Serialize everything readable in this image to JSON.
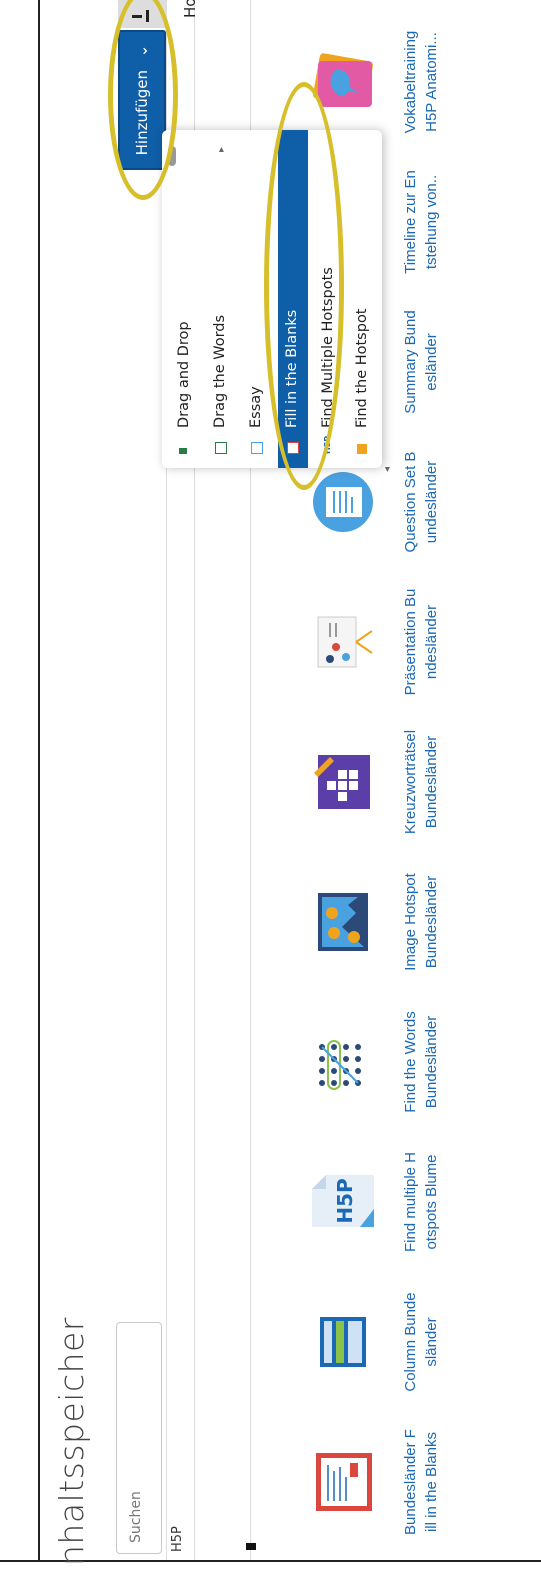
{
  "page_title": "nhaltsspeicher",
  "search": {
    "placeholder": "Suchen"
  },
  "breadcrumb": "H5P",
  "toolbar": {
    "add_label": "Hinzufügen",
    "add_chevron": "⌄",
    "upload_label": "Hochladen",
    "upload_icon": "upload-icon"
  },
  "tiles": [
    {
      "name": "Bundesländer F\nill in the Blanks",
      "icon": "fill-blanks-icon"
    },
    {
      "name": "Column Bunde\nsländer",
      "icon": "column-icon"
    },
    {
      "name": "Find multiple H\notspots Blume",
      "icon": "h5p-file-icon"
    },
    {
      "name": "Find the Words\nBundesländer",
      "icon": "find-words-icon"
    },
    {
      "name": "Image Hotspot\nBundesländer",
      "icon": "image-hotspot-icon"
    },
    {
      "name": "Kreuzworträtsel\nBundesländer",
      "icon": "crossword-icon"
    },
    {
      "name": "Präsentation Bu\nndesländer",
      "icon": "presentation-icon"
    },
    {
      "name": "Question Set B\nundesländer",
      "icon": "question-set-icon"
    },
    {
      "name": "Summary Bund\nesländer",
      "icon": "summary-icon"
    },
    {
      "name": "Timeline zur En\ntstehung von..",
      "icon": "timeline-icon"
    },
    {
      "name": "Vokabeltraining\nH5P Anatomi...",
      "icon": "vocabulary-icon"
    }
  ],
  "dropdown": {
    "items": [
      {
        "label": "Drag and Drop",
        "icon": "drag-drop-icon",
        "selected": false
      },
      {
        "label": "Drag the Words",
        "icon": "drag-words-icon",
        "selected": false
      },
      {
        "label": "Essay",
        "icon": "essay-icon",
        "selected": false
      },
      {
        "label": "Fill in the Blanks",
        "icon": "fill-blanks-icon",
        "selected": true
      },
      {
        "label": "Find Multiple Hotspots",
        "icon": "h5p-icon",
        "selected": false
      },
      {
        "label": "Find the Hotspot",
        "icon": "hotspot-icon",
        "selected": false
      }
    ]
  },
  "colors": {
    "accent": "#0f5ea8",
    "link": "#1b69b5",
    "highlight": "#d6bf2a"
  }
}
